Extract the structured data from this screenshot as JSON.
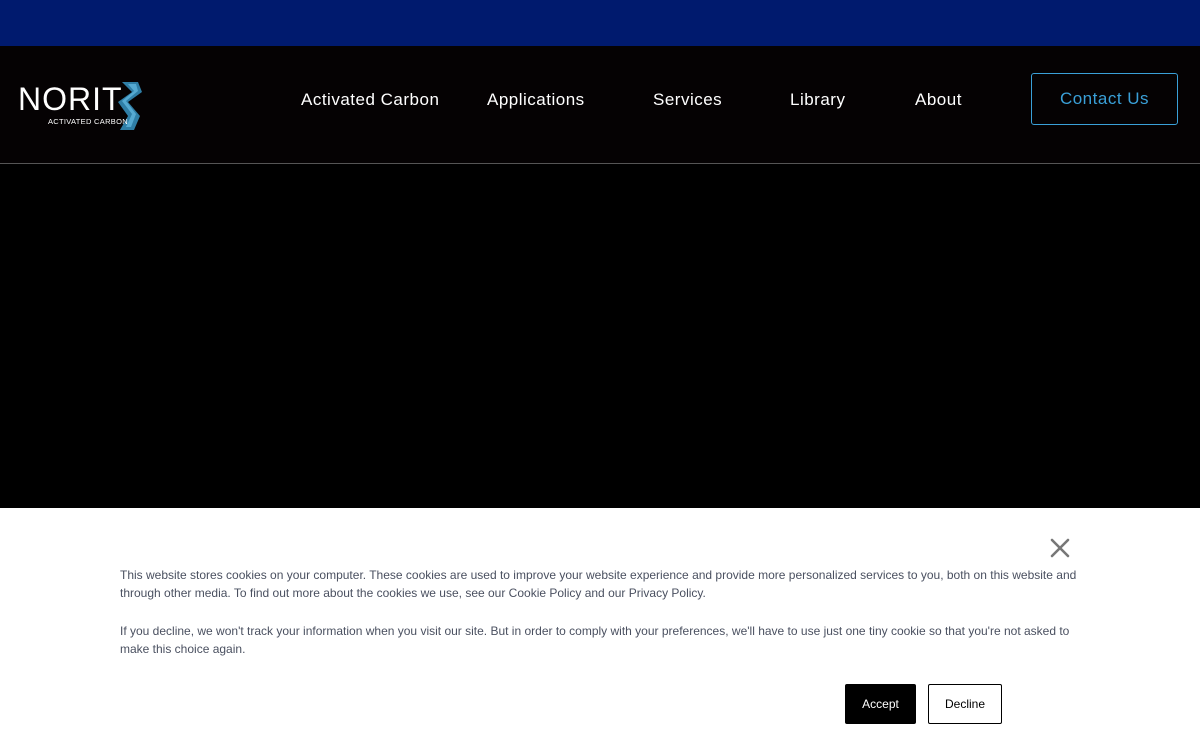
{
  "colors": {
    "top_bar": "#001a6e",
    "header_bg": "#050203",
    "accent": "#3aa0d8",
    "cookie_text": "#4a5060"
  },
  "logo": {
    "word": "NORIT",
    "subtitle": "ACTIVATED CARBON",
    "icon": "norit-wave-logo-icon"
  },
  "nav": {
    "items": [
      {
        "label": "Activated Carbon"
      },
      {
        "label": "Applications"
      },
      {
        "label": "Services"
      },
      {
        "label": "Library"
      },
      {
        "label": "About"
      }
    ],
    "contact_label": "Contact Us"
  },
  "cookie_banner": {
    "paragraph1": "This website stores cookies on your computer. These cookies are used to improve your website experience and provide more personalized services to you, both on this website and through other media. To find out more about the cookies we use, see our Cookie Policy and our Privacy Policy.",
    "paragraph2": "If you decline, we won't track your information when you visit our site. But in order to comply with your preferences, we'll have to use just one tiny cookie so that you're not asked to make this choice again.",
    "accept_label": "Accept",
    "decline_label": "Decline",
    "close_icon": "close-icon"
  }
}
